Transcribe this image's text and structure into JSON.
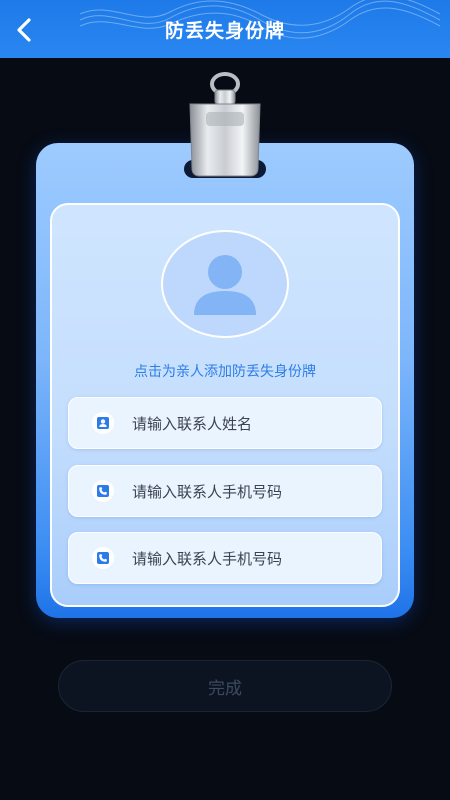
{
  "header": {
    "title": "防丢失身份牌",
    "back_icon": "chevron-left-icon",
    "color": "#2a86f0"
  },
  "card": {
    "avatar_icon": "user-silhouette-icon",
    "hint": "点击为亲人添加防丢失身份牌",
    "fields": [
      {
        "icon": "contact-card-icon",
        "placeholder": "请输入联系人姓名"
      },
      {
        "icon": "phone-icon",
        "placeholder": "请输入联系人手机号码"
      },
      {
        "icon": "phone-icon",
        "placeholder": "请输入联系人手机号码"
      }
    ]
  },
  "footer": {
    "done_label": "完成"
  }
}
